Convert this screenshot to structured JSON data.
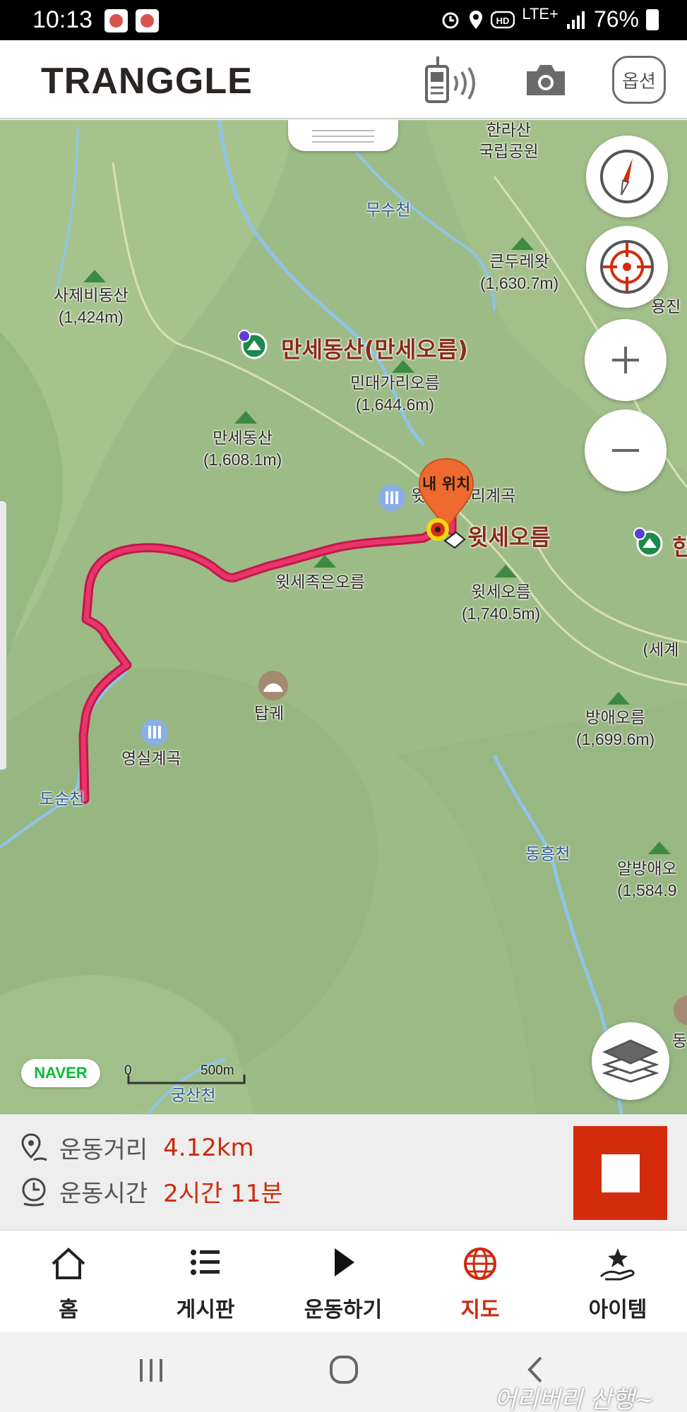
{
  "status_bar": {
    "time": "10:13",
    "network": "LTE+",
    "battery": "76%"
  },
  "header": {
    "logo": "TRANGGLE",
    "options_label": "옵션"
  },
  "map": {
    "labels": {
      "hallasan": [
        "한라산",
        "국립공원"
      ],
      "musucheon": "무수천",
      "keundure": {
        "name": "큰두레왓",
        "height": "(1,630.7m)"
      },
      "sajebi": {
        "name": "사제비동산",
        "height": "(1,424m)"
      },
      "yongjin": "용진",
      "manse_poi": "만세동산(만세오름)",
      "mindaegari": {
        "name": "민대가리오름",
        "height": "(1,644.6m)"
      },
      "manse": {
        "name": "만세동산",
        "height": "(1,608.1m)"
      },
      "valley_upper": "윗방밭다리계곡",
      "my_location": "내 위치",
      "witse_poi": "윗세오름",
      "han": "한",
      "witsejok": "윗세족은오름",
      "witse": {
        "name": "윗세오름",
        "height": "(1,740.5m)"
      },
      "segye": "(세계",
      "tapgwe": "탑궤",
      "bangae": {
        "name": "방애오름",
        "height": "(1,699.6m)"
      },
      "yeongsil": "영실계곡",
      "dosuncheon": "도순천",
      "donghung": "동흥천",
      "albangae": {
        "name": "알방애오",
        "height": "(1,584.9"
      },
      "dong": "동",
      "gungsan": "궁산천"
    },
    "scale": {
      "zero": "0",
      "distance": "500m"
    },
    "attribution": "NAVER",
    "colors": {
      "track": "#e8356b",
      "land": "#9dbb86",
      "stream": "#8ec4e8"
    }
  },
  "stats": {
    "distance_label": "운동거리",
    "distance_value": "4.12km",
    "time_label": "운동시간",
    "time_value": "2시간 11분"
  },
  "bottom_nav": [
    {
      "label": "홈",
      "icon": "home-icon"
    },
    {
      "label": "게시판",
      "icon": "list-icon"
    },
    {
      "label": "운동하기",
      "icon": "play-icon"
    },
    {
      "label": "지도",
      "icon": "globe-icon",
      "active": true
    },
    {
      "label": "아이템",
      "icon": "hand-star-icon"
    }
  ],
  "watermark": "어리버리 산행~"
}
